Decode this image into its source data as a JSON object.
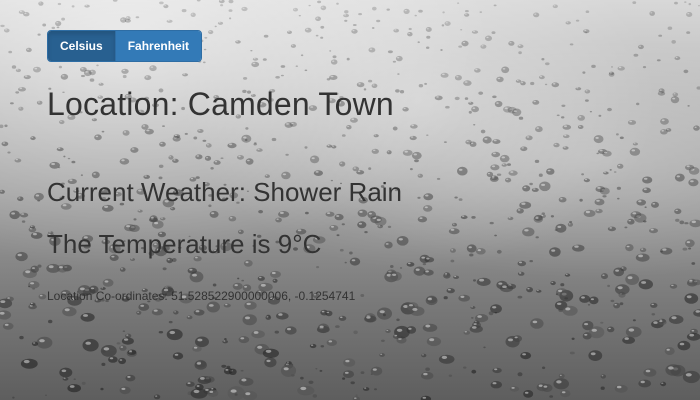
{
  "unit_toggle": {
    "celsius_label": "Celsius",
    "fahrenheit_label": "Fahrenheit",
    "selected": "Celsius"
  },
  "location": {
    "title": "Location: Camden Town"
  },
  "weather": {
    "current": "Current Weather: Shower Rain",
    "temperature": "The Temperature is 9°C"
  },
  "coordinates": {
    "text": "Location Co-ordinates: 51.528522900000006, -0.1254741"
  },
  "colors": {
    "button_primary": "#337ab7",
    "button_active": "#286090",
    "text": "#333333"
  }
}
